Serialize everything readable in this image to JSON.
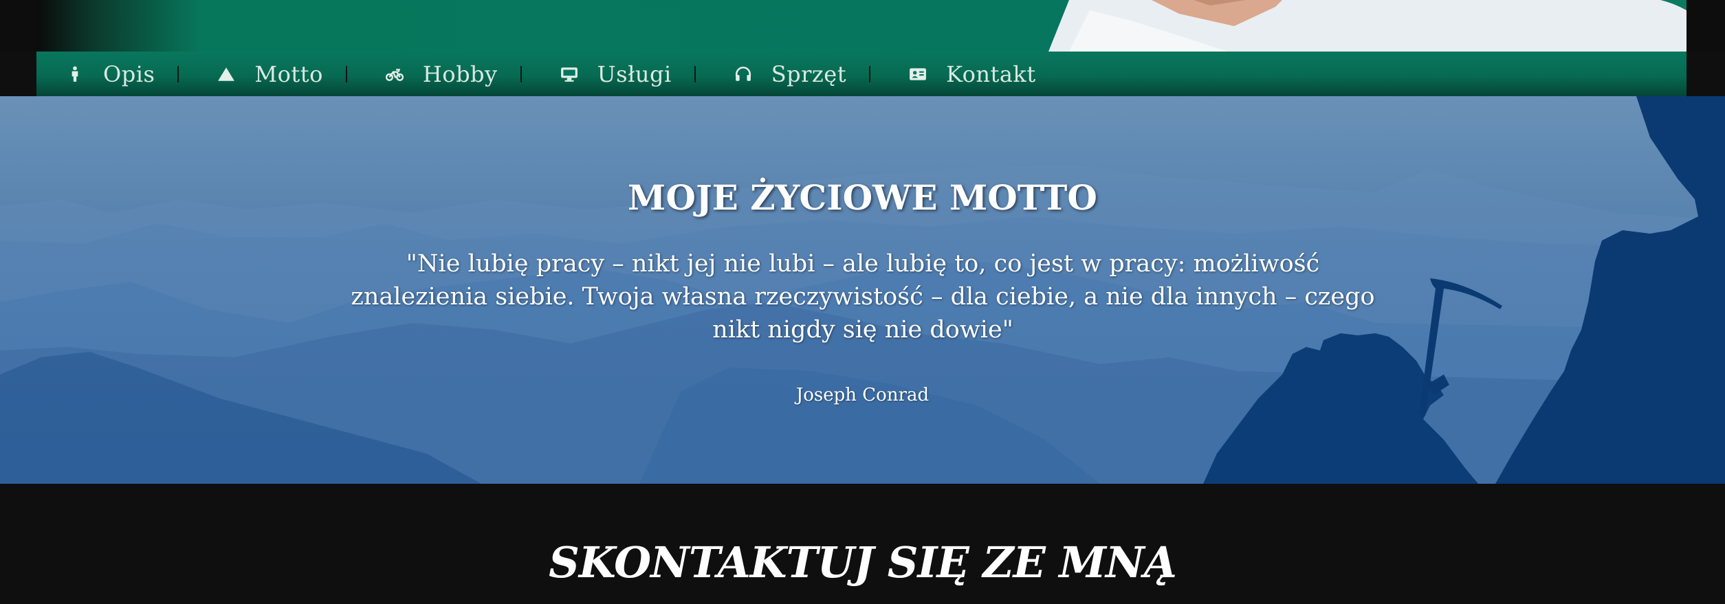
{
  "nav": {
    "items": [
      {
        "label": "Opis",
        "icon": "person-icon"
      },
      {
        "label": "Motto",
        "icon": "mountain-icon"
      },
      {
        "label": "Hobby",
        "icon": "motorcycle-icon"
      },
      {
        "label": "Usługi",
        "icon": "desktop-icon"
      },
      {
        "label": "Sprzęt",
        "icon": "headphones-icon"
      },
      {
        "label": "Kontakt",
        "icon": "id-card-icon"
      }
    ]
  },
  "motto": {
    "title": "MOJE ŻYCIOWE MOTTO",
    "quote": "\"Nie lubię pracy – nikt jej nie lubi – ale lubię to, co jest w pracy: możliwość znalezienia siebie. Twoja własna rzeczywistość – dla ciebie, a nie dla innych – czego nikt nigdy się nie dowie\"",
    "author": "Joseph Conrad"
  },
  "contact": {
    "title": "SKONTAKTUJ SIĘ ZE MNĄ"
  },
  "colors": {
    "nav_bg": "#077660",
    "motto_bg": "#4d7bad",
    "page_bg": "#0f0f0f"
  }
}
